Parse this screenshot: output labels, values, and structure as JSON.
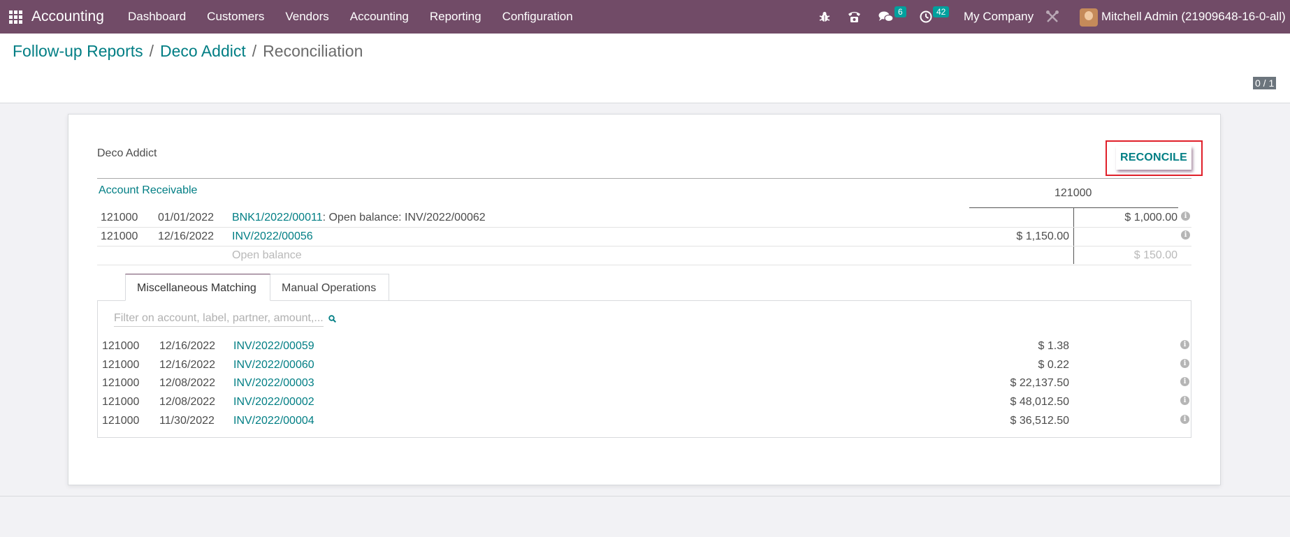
{
  "navbar": {
    "app_name": "Accounting",
    "menu": [
      "Dashboard",
      "Customers",
      "Vendors",
      "Accounting",
      "Reporting",
      "Configuration"
    ],
    "messages_count": "6",
    "activities_count": "42",
    "company": "My Company",
    "user": "Mitchell Admin (21909648-16-0-all)"
  },
  "breadcrumb": {
    "items": [
      "Follow-up Reports",
      "Deco Addict"
    ],
    "current": "Reconciliation"
  },
  "pager": "0 / 1",
  "sheet": {
    "partner": "Deco Addict",
    "reconcile_label": "RECONCILE",
    "account_title": "Account Receivable",
    "account_code": "121000",
    "moves": [
      {
        "account": "121000",
        "date": "01/01/2022",
        "ref": "BNK1/2022/00011",
        "label": ": Open balance: INV/2022/00062",
        "debit": "",
        "credit": "$ 1,000.00"
      },
      {
        "account": "121000",
        "date": "12/16/2022",
        "ref": "INV/2022/00056",
        "label": "",
        "debit": "$ 1,150.00",
        "credit": ""
      }
    ],
    "open_balance": {
      "label": "Open balance",
      "amount": "$ 150.00"
    },
    "tabs": [
      "Miscellaneous Matching",
      "Manual Operations"
    ],
    "filter_placeholder": "Filter on account, label, partner, amount,...",
    "proposals": [
      {
        "account": "121000",
        "date": "12/16/2022",
        "ref": "INV/2022/00059",
        "amount": "$ 1.38"
      },
      {
        "account": "121000",
        "date": "12/16/2022",
        "ref": "INV/2022/00060",
        "amount": "$ 0.22"
      },
      {
        "account": "121000",
        "date": "12/08/2022",
        "ref": "INV/2022/00003",
        "amount": "$ 22,137.50"
      },
      {
        "account": "121000",
        "date": "12/08/2022",
        "ref": "INV/2022/00002",
        "amount": "$ 48,012.50"
      },
      {
        "account": "121000",
        "date": "11/30/2022",
        "ref": "INV/2022/00004",
        "amount": "$ 36,512.50"
      }
    ]
  },
  "icons": {
    "apps": "apps-grid-icon",
    "debug": "bug-icon",
    "phone": "phone-icon",
    "messages": "chat-icon",
    "activities": "clock-icon",
    "settings": "tools-icon",
    "info": "info-icon",
    "search": "search-icon"
  },
  "colors": {
    "navbar": "#714b67",
    "link": "#017e84",
    "badge": "#00a09d",
    "highlight_frame": "#e0202a"
  }
}
